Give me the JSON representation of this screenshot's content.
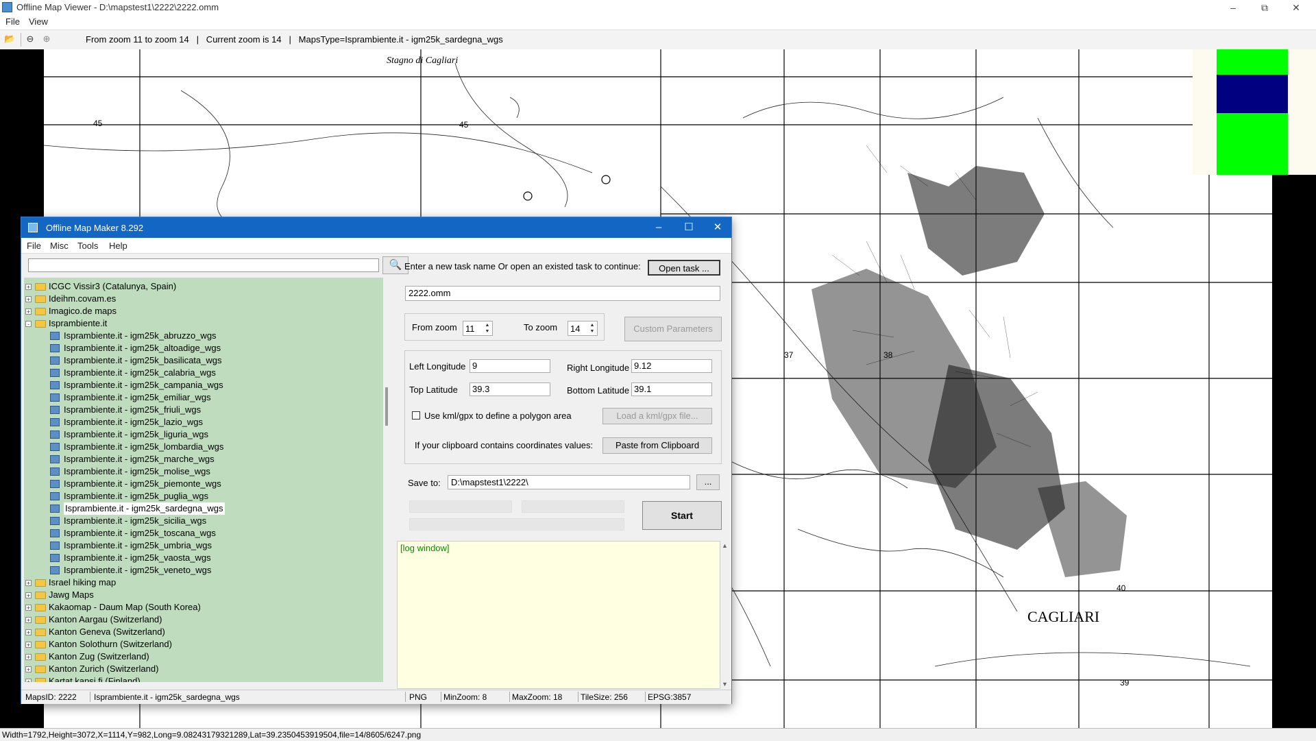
{
  "viewer": {
    "title": "Offline Map Viewer - D:\\mapstest1\\2222\\2222.omm",
    "menu": [
      "File",
      "View"
    ],
    "toolbar_info": "From zoom 11 to zoom 14   |   Current zoom is 14   |   MapsType=Isprambiente.it - igm25k_sardegna_wgs",
    "status": "Width=1792,Height=3072,X=1114,Y=982,Long=9.08243179321289,Lat=39.2350453919504,file=14/8605/6247.png"
  },
  "map_labels": {
    "stagno": "Stagno    di    Cagliari",
    "city": "CAGLIARI",
    "grid45a": "45",
    "grid45b": "45",
    "grid40": "40",
    "grid39": "39",
    "grid37": "37",
    "grid38": "38"
  },
  "dialog": {
    "title": "Offline Map Maker 8.292",
    "menu": [
      "File",
      "Misc",
      "Tools",
      "Help"
    ],
    "search_value": "",
    "tree": [
      {
        "level": 0,
        "type": "folder",
        "exp": "+",
        "label": "ICGC Vissir3 (Catalunya, Spain)"
      },
      {
        "level": 0,
        "type": "folder",
        "exp": "+",
        "label": "Ideihm.covam.es"
      },
      {
        "level": 0,
        "type": "folder",
        "exp": "+",
        "label": "Imagico.de maps"
      },
      {
        "level": 0,
        "type": "folder",
        "exp": "-",
        "label": "Isprambiente.it"
      },
      {
        "level": 1,
        "type": "map",
        "label": "Isprambiente.it - igm25k_abruzzo_wgs"
      },
      {
        "level": 1,
        "type": "map",
        "label": "Isprambiente.it - igm25k_altoadige_wgs"
      },
      {
        "level": 1,
        "type": "map",
        "label": "Isprambiente.it - igm25k_basilicata_wgs"
      },
      {
        "level": 1,
        "type": "map",
        "label": "Isprambiente.it - igm25k_calabria_wgs"
      },
      {
        "level": 1,
        "type": "map",
        "label": "Isprambiente.it - igm25k_campania_wgs"
      },
      {
        "level": 1,
        "type": "map",
        "label": "Isprambiente.it - igm25k_emiliar_wgs"
      },
      {
        "level": 1,
        "type": "map",
        "label": "Isprambiente.it - igm25k_friuli_wgs"
      },
      {
        "level": 1,
        "type": "map",
        "label": "Isprambiente.it - igm25k_lazio_wgs"
      },
      {
        "level": 1,
        "type": "map",
        "label": "Isprambiente.it - igm25k_liguria_wgs"
      },
      {
        "level": 1,
        "type": "map",
        "label": "Isprambiente.it - igm25k_lombardia_wgs"
      },
      {
        "level": 1,
        "type": "map",
        "label": "Isprambiente.it - igm25k_marche_wgs"
      },
      {
        "level": 1,
        "type": "map",
        "label": "Isprambiente.it - igm25k_molise_wgs"
      },
      {
        "level": 1,
        "type": "map",
        "label": "Isprambiente.it - igm25k_piemonte_wgs"
      },
      {
        "level": 1,
        "type": "map",
        "label": "Isprambiente.it - igm25k_puglia_wgs"
      },
      {
        "level": 1,
        "type": "map",
        "label": "Isprambiente.it - igm25k_sardegna_wgs",
        "selected": true
      },
      {
        "level": 1,
        "type": "map",
        "label": "Isprambiente.it - igm25k_sicilia_wgs"
      },
      {
        "level": 1,
        "type": "map",
        "label": "Isprambiente.it - igm25k_toscana_wgs"
      },
      {
        "level": 1,
        "type": "map",
        "label": "Isprambiente.it - igm25k_umbria_wgs"
      },
      {
        "level": 1,
        "type": "map",
        "label": "Isprambiente.it - igm25k_vaosta_wgs"
      },
      {
        "level": 1,
        "type": "map",
        "label": "Isprambiente.it - igm25k_veneto_wgs"
      },
      {
        "level": 0,
        "type": "folder",
        "exp": "+",
        "label": "Israel hiking map"
      },
      {
        "level": 0,
        "type": "folder",
        "exp": "+",
        "label": "Jawg Maps"
      },
      {
        "level": 0,
        "type": "folder",
        "exp": "+",
        "label": "Kakaomap - Daum Map (South Korea)"
      },
      {
        "level": 0,
        "type": "folder",
        "exp": "+",
        "label": "Kanton Aargau (Switzerland)"
      },
      {
        "level": 0,
        "type": "folder",
        "exp": "+",
        "label": "Kanton Geneva (Switzerland)"
      },
      {
        "level": 0,
        "type": "folder",
        "exp": "+",
        "label": "Kanton Solothurn (Switzerland)"
      },
      {
        "level": 0,
        "type": "folder",
        "exp": "+",
        "label": "Kanton Zug (Switzerland)"
      },
      {
        "level": 0,
        "type": "folder",
        "exp": "+",
        "label": "Kanton Zurich (Switzerland)"
      },
      {
        "level": 0,
        "type": "folder",
        "exp": "+",
        "label": "Kartat.kapsi.fi (Finland)"
      }
    ],
    "task_prompt": "Enter a new task name Or open an existed task to continue:",
    "open_task": "Open task ...",
    "task_name": "2222.omm",
    "from_zoom_label": "From zoom",
    "from_zoom": "11",
    "to_zoom_label": "To zoom",
    "to_zoom": "14",
    "custom_params": "Custom Parameters",
    "left_lon_label": "Left Longitude",
    "left_lon": "9",
    "right_lon_label": "Right Longitude",
    "right_lon": "9.12",
    "top_lat_label": "Top Latitude",
    "top_lat": "39.3",
    "bottom_lat_label": "Bottom Latitude",
    "bottom_lat": "39.1",
    "kml_label": "Use kml/gpx to define a polygon area",
    "kml_checked": false,
    "load_kml": "Load a kml/gpx file...",
    "clipboard_label": "If your clipboard contains coordinates values:",
    "paste_btn": "Paste from Clipboard",
    "save_to_label": "Save to:",
    "save_to": "D:\\mapstest1\\2222\\",
    "browse": "...",
    "start": "Start",
    "log": "[log window]",
    "status": {
      "mapsid": "MapsID: 2222",
      "maptype": "Isprambiente.it - igm25k_sardegna_wgs",
      "format": "PNG",
      "minzoom": "MinZoom: 8",
      "maxzoom": "MaxZoom: 18",
      "tilesize": "TileSize: 256",
      "epsg": "EPSG:3857"
    }
  },
  "colors": {
    "accent": "#1366c4",
    "tree_bg": "#bfdcbf",
    "log_bg": "#ffffe1",
    "log_text": "#009000",
    "overview_green": "#00ff00",
    "overview_navy": "#000080"
  }
}
